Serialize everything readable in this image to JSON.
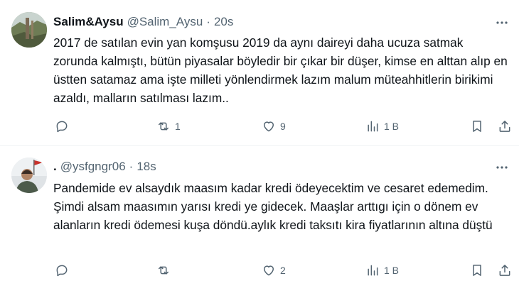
{
  "tweets": [
    {
      "name": "Salim&Aysu",
      "handle": "@Salim_Aysu",
      "separator": "·",
      "time": "20s",
      "text": "2017 de satılan evin yan komşusu 2019 da aynı daireyi daha ucuza satmak zorunda kalmıştı, bütün piyasalar böyledir bir çıkar bir düşer, kimse en alttan alıp en üstten satamaz ama işte milleti yönlendirmek lazım malum müteahhitlerin birikimi azaldı, malların satılması lazım..",
      "replies": "",
      "retweets": "1",
      "likes": "9",
      "views": "1 B"
    },
    {
      "name": ".",
      "handle": "@ysfgngr06",
      "separator": "·",
      "time": "18s",
      "text": "Pandemide ev alsaydık maasım kadar kredi ödeyecektim ve cesaret edemedim. Şimdi alsam maasımın yarısı kredi ye gidecek. Maaşlar  arttıgı için o dönem ev alanların kredi ödemesi kuşa döndü.aylık kredi taksıtı kira fiyatlarının altına düştü",
      "replies": "",
      "retweets": "",
      "likes": "2",
      "views": "1 B"
    }
  ],
  "icons": {
    "reply": "reply-icon",
    "retweet": "retweet-icon",
    "like": "heart-icon",
    "views": "views-icon",
    "bookmark": "bookmark-icon",
    "share": "share-icon",
    "more": "more-icon"
  },
  "colors": {
    "text": "#0f1419",
    "secondary": "#536471",
    "divider": "#eff3f4"
  }
}
